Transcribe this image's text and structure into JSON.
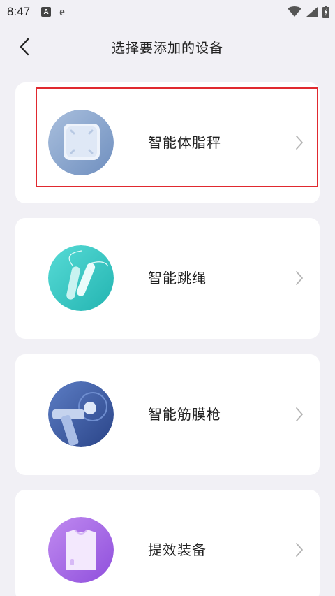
{
  "status_bar": {
    "time": "8:47",
    "a_icon": "A",
    "e_icon": "e"
  },
  "header": {
    "title": "选择要添加的设备"
  },
  "devices": [
    {
      "label": "智能体脂秤",
      "icon": "scale-icon",
      "color": "#8aa7cf"
    },
    {
      "label": "智能跳绳",
      "icon": "jump-rope-icon",
      "color": "#35c9c4"
    },
    {
      "label": "智能筋膜枪",
      "icon": "massage-gun-icon",
      "color": "#3e5ea8"
    },
    {
      "label": "提效装备",
      "icon": "apparel-icon",
      "color": "#a667e6"
    }
  ],
  "colors": {
    "background": "#f1f0f5",
    "card": "#ffffff",
    "highlight": "#e0292f"
  }
}
